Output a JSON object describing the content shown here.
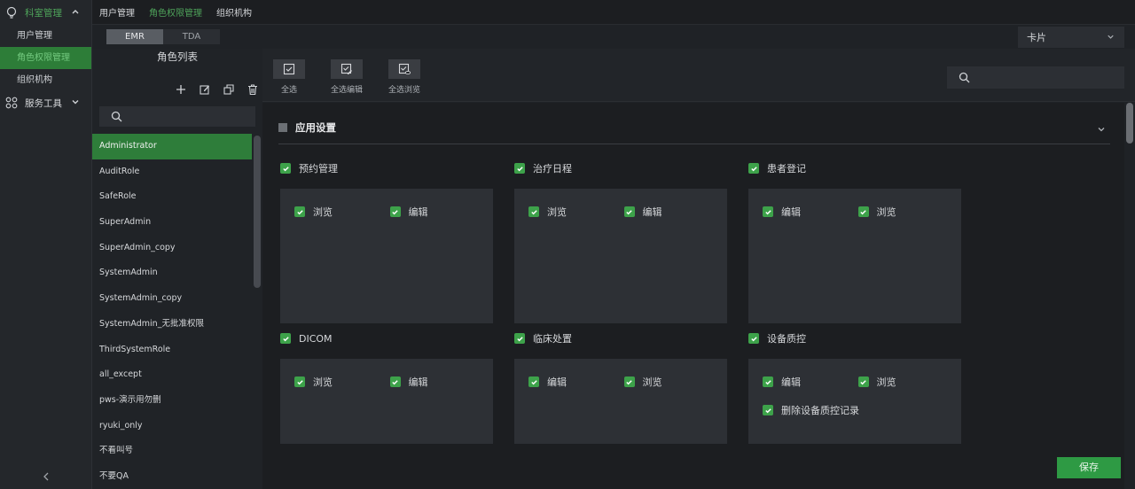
{
  "nav": {
    "groups": [
      {
        "label": "科室管理",
        "icon": "bulb-icon",
        "expanded": true
      },
      {
        "label": "服务工具",
        "icon": "grid-icon",
        "expanded": false
      }
    ],
    "sub_items": [
      "用户管理",
      "角色权限管理",
      "组织机构"
    ],
    "active_sub": "角色权限管理"
  },
  "top_tabs": [
    "用户管理",
    "角色权限管理",
    "组织机构"
  ],
  "active_tab": "角色权限管理",
  "segment": {
    "options": [
      "EMR",
      "TDA"
    ],
    "selected": "EMR"
  },
  "view_select": {
    "value": "卡片"
  },
  "role_panel": {
    "title": "角色列表",
    "tools": [
      "plus-icon",
      "edit-icon",
      "copy-icon",
      "trash-icon"
    ],
    "search_placeholder": "",
    "roles": [
      "Administrator",
      "AuditRole",
      "SafeRole",
      "SuperAdmin",
      "SuperAdmin_copy",
      "SystemAdmin",
      "SystemAdmin_copy",
      "SystemAdmin_无批准权限",
      "ThirdSystemRole",
      "all_except",
      "pws-演示用勿删",
      "ryuki_only",
      "不看叫号",
      "不要QA"
    ],
    "selected": "Administrator"
  },
  "toolbar": {
    "select_all": "全选",
    "select_all_edit": "全选编辑",
    "select_all_view": "全选浏览",
    "search_placeholder": ""
  },
  "section": {
    "title": "应用设置"
  },
  "modules": [
    {
      "title": "预约管理",
      "perms": [
        "浏览",
        "编辑"
      ]
    },
    {
      "title": "治疗日程",
      "perms": [
        "浏览",
        "编辑"
      ]
    },
    {
      "title": "患者登记",
      "perms": [
        "编辑",
        "浏览"
      ]
    },
    {
      "title": "DICOM",
      "perms": [
        "浏览",
        "编辑"
      ]
    },
    {
      "title": "临床处置",
      "perms": [
        "编辑",
        "浏览"
      ]
    },
    {
      "title": "设备质控",
      "perms": [
        "编辑",
        "浏览"
      ],
      "extra": "删除设备质控记录"
    }
  ],
  "save_label": "保存",
  "colors": {
    "accent": "#3da24a",
    "active_bg": "#2e7d3a",
    "panel": "#2d3035"
  }
}
